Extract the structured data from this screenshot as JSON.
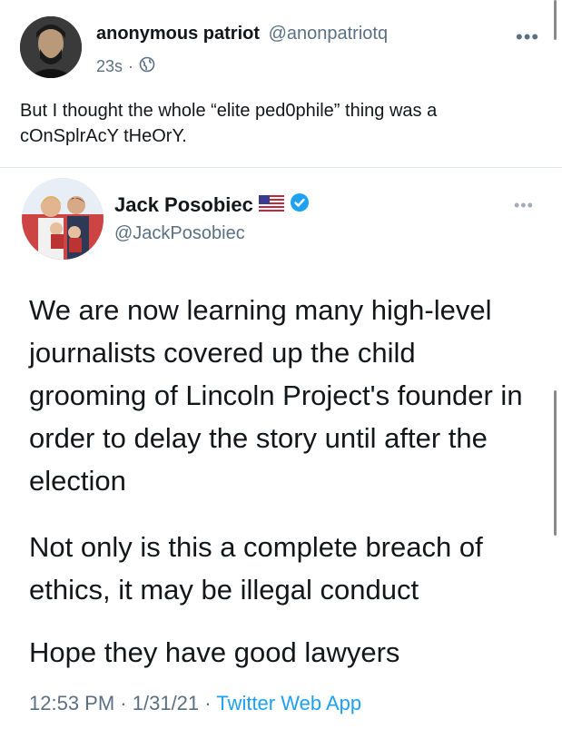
{
  "outer_tweet": {
    "display_name": "anonymous patriot",
    "handle": "@anonpatriotq",
    "time": "23s",
    "separator": "·",
    "text": "But I thought the whole “elite ped0phile” thing was a cOnSplrAcY tHeOrY."
  },
  "quoted_tweet": {
    "display_name": "Jack Posobiec",
    "handle": "@JackPosobiec",
    "paragraphs": [
      "We are now learning many high-level journalists covered up the child grooming of Lincoln Project's founder in order to delay the story until after the election",
      "Not only is this a complete breach of ethics, it may be illegal conduct",
      "Hope they have good lawyers"
    ],
    "time": "12:53 PM",
    "date": "1/31/21",
    "separator": "·",
    "source": "Twitter Web App"
  },
  "icons": {
    "more": "more-icon",
    "globe": "globe-icon",
    "flag": "us-flag-icon",
    "verified": "verified-badge-icon"
  },
  "colors": {
    "text": "#14171a",
    "secondary": "#5b7083",
    "link": "#1da1f2",
    "divider": "#e1e8ed"
  }
}
